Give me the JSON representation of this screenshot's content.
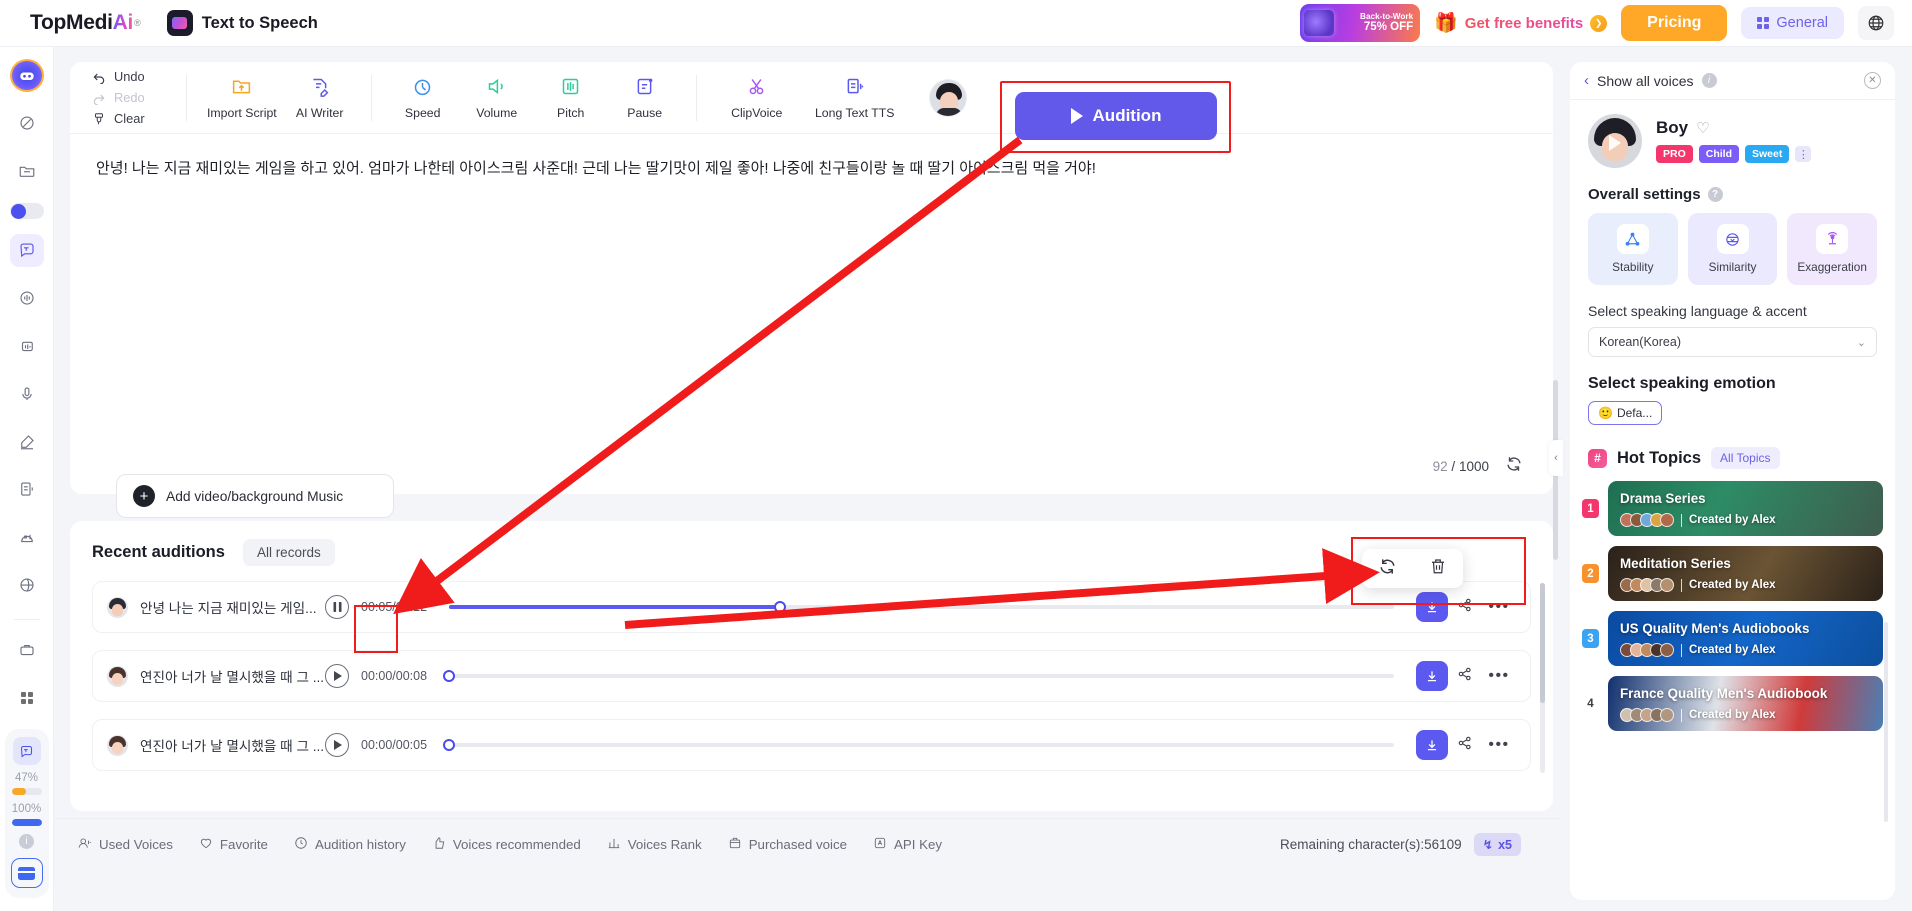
{
  "header": {
    "logo_text": "TopMedi",
    "logo_ai": "Ai",
    "logo_reg": "®",
    "product_name": "Text to Speech",
    "promo": {
      "line1": "Back-to-Work",
      "line2": "75% OFF"
    },
    "benefits_label": "Get free benefits",
    "benefits_arrow": "❯",
    "pricing_label": "Pricing",
    "general_label": "General",
    "globe_icon": "⊕"
  },
  "rail": {
    "items": [
      {
        "name": "home-brand-icon",
        "glyph": "◉"
      },
      {
        "name": "magic-wand-icon",
        "glyph": "⊘"
      },
      {
        "name": "folder-icon",
        "glyph": "□"
      }
    ],
    "toggle_on": true,
    "tools": [
      {
        "name": "text-to-speech-icon",
        "glyph": "Ⓣ",
        "active": true
      },
      {
        "name": "voice-changer-icon",
        "glyph": "◎"
      },
      {
        "name": "voice-cloning-icon",
        "glyph": "▤"
      },
      {
        "name": "microphone-icon",
        "glyph": "Ἲ4"
      },
      {
        "name": "ai-voice-recorder-icon",
        "glyph": "✎"
      },
      {
        "name": "long-text-tts-icon",
        "glyph": "≣"
      },
      {
        "name": "speech-to-text-icon",
        "glyph": "⌘"
      },
      {
        "name": "translate-icon",
        "glyph": "☸"
      },
      {
        "name": "briefcase-icon",
        "glyph": "⊞"
      }
    ],
    "apps_icon": "∷",
    "usage": {
      "percent_1": "47%",
      "percent_1_value": 47,
      "percent_1_color": "#f9a825",
      "percent_2": "100%",
      "percent_2_value": 100,
      "percent_2_color": "#3e68ef"
    }
  },
  "toolbar": {
    "undo": "Undo",
    "redo": "Redo",
    "clear": "Clear",
    "buttons": [
      {
        "label": "Import Script",
        "icon": "folder-upload-icon",
        "glyph": "📁",
        "color": "#f5a623"
      },
      {
        "label": "AI Writer",
        "icon": "ai-writer-icon",
        "glyph": "📝",
        "color": "#5b59ef"
      },
      {
        "label": "Speed",
        "icon": "speed-icon",
        "glyph": "⏱",
        "color": "#3b8ef0"
      },
      {
        "label": "Volume",
        "icon": "volume-icon",
        "glyph": "🔊",
        "color": "#2ecc9b"
      },
      {
        "label": "Pitch",
        "icon": "pitch-icon",
        "glyph": "⫼",
        "color": "#2ecc9b"
      },
      {
        "label": "Pause",
        "icon": "pause-insert-icon",
        "glyph": "📄",
        "color": "#5b59ef"
      },
      {
        "label": "ClipVoice",
        "icon": "scissors-icon",
        "glyph": "✂",
        "color": "#a855f7"
      },
      {
        "label": "Long Text TTS",
        "icon": "long-text-tts-icon",
        "glyph": "📃",
        "color": "#5b59ef"
      }
    ],
    "audition_label": "Audition"
  },
  "editor": {
    "script": "안녕! 나는 지금 재미있는 게임을 하고 있어. 엄마가 나한테 아이스크림 사준대! 근데 나는 딸기맛이 제일 좋아! 나중에 친구들이랑 놀 때 딸기 아이스크림 먹을 거야!",
    "add_media_label": "Add video/background Music",
    "char_current": "92",
    "char_sep": "/",
    "char_max": "1000",
    "refresh_icon": "↻"
  },
  "recent": {
    "title": "Recent auditions",
    "all_records_label": "All records",
    "hover_actions": [
      {
        "name": "regenerate-icon",
        "glyph": "↻"
      },
      {
        "name": "delete-icon",
        "glyph": "🗑"
      }
    ],
    "rows": [
      {
        "name": "안녕 나는 지금 재미있는 게임...",
        "time": "00:05/00:12",
        "state": "playing",
        "play_glyph": "▐▐",
        "progress": 35,
        "avatar": "boy"
      },
      {
        "name": "연진아 너가 날 멸시했을 때 그 ...",
        "time": "00:00/00:08",
        "state": "paused",
        "play_glyph": "▶",
        "progress": 0,
        "avatar": "girl"
      },
      {
        "name": "연진아 너가 날 멸시했을 때 그 ...",
        "time": "00:00/00:05",
        "state": "paused",
        "play_glyph": "▶",
        "progress": 0,
        "avatar": "girl"
      }
    ],
    "download_icon": "⬇",
    "share_icon": "➦",
    "more_icon": "•••"
  },
  "bottom_bar": {
    "items": [
      {
        "label": "Used Voices",
        "icon": "used-voices-icon",
        "glyph": "♪"
      },
      {
        "label": "Favorite",
        "icon": "heart-icon",
        "glyph": "♡"
      },
      {
        "label": "Audition history",
        "icon": "history-icon",
        "glyph": "◴"
      },
      {
        "label": "Voices recommended",
        "icon": "thumbs-up-icon",
        "glyph": "☝"
      },
      {
        "label": "Voices Rank",
        "icon": "rank-bars-icon",
        "glyph": "☰"
      },
      {
        "label": "Purchased voice",
        "icon": "purchased-icon",
        "glyph": "▦"
      },
      {
        "label": "API Key",
        "icon": "api-key-icon",
        "glyph": "Ⓐ"
      }
    ],
    "remaining": "Remaining character(s):56109",
    "multiplier": "x5",
    "multiplier_icon": "↯"
  },
  "right_panel": {
    "header_title": "Show all voices",
    "back_icon": "‹",
    "close_icon": "✕",
    "voice": {
      "name": "Boy",
      "heart_icon": "♡",
      "tags": [
        {
          "label": "PRO",
          "color": "#f5366d"
        },
        {
          "label": "Child",
          "color": "#7b5cf6"
        },
        {
          "label": "Sweet",
          "color": "#29a9f2"
        }
      ],
      "dots_icon": "⋮"
    },
    "overall_settings_title": "Overall settings",
    "settings": [
      {
        "label": "Stability",
        "icon": "stability-icon",
        "glyph": "△",
        "bg": "#e8eefc",
        "color": "#3b82f6"
      },
      {
        "label": "Similarity",
        "icon": "similarity-icon",
        "glyph": "⊜",
        "bg": "#ebe9fd",
        "color": "#5b59ef"
      },
      {
        "label": "Exaggeration",
        "icon": "exaggeration-icon",
        "glyph": "☉",
        "bg": "#f1e8fd",
        "color": "#a855f7"
      }
    ],
    "language_label": "Select speaking language & accent",
    "language_value": "Korean(Korea)",
    "chevron_icon": "⌄",
    "emotion_label": "Select speaking emotion",
    "emotion_value": "Defa...",
    "emotion_emoji": "🙂",
    "hot_topics_title": "Hot Topics",
    "hash_icon": "#",
    "all_topics_label": "All Topics",
    "topics": [
      {
        "rank": "1",
        "rank_color": "#f5366d",
        "name": "Drama Series",
        "author": "Created by Alex",
        "bg": "linear-gradient(120deg,#1f6f52 0%, #2d8c66 40%, #3f5c4e 100%)"
      },
      {
        "rank": "2",
        "rank_color": "#f7922e",
        "name": "Meditation Series",
        "author": "Created by Alex",
        "bg": "linear-gradient(120deg,#2a211a 0%, #6b5434 55%, #2b2219 100%)"
      },
      {
        "rank": "3",
        "rank_color": "#3ba3f2",
        "name": "US Quality Men's Audiobooks",
        "author": "Created by Alex",
        "bg": "linear-gradient(120deg,#0b4aa0 0%, #1366c9 50%, #0d4f9e 100%)"
      },
      {
        "rank": "4",
        "rank_color": "transparent",
        "name": "France Quality Men's Audiobook",
        "author": "Created by Alex",
        "bg": "linear-gradient(100deg,#11306e 0%, #dfe3e8 40%, #d03b3b 70%, #4a7fb5 100%)"
      }
    ]
  },
  "collapse_handle_icon": "‹"
}
